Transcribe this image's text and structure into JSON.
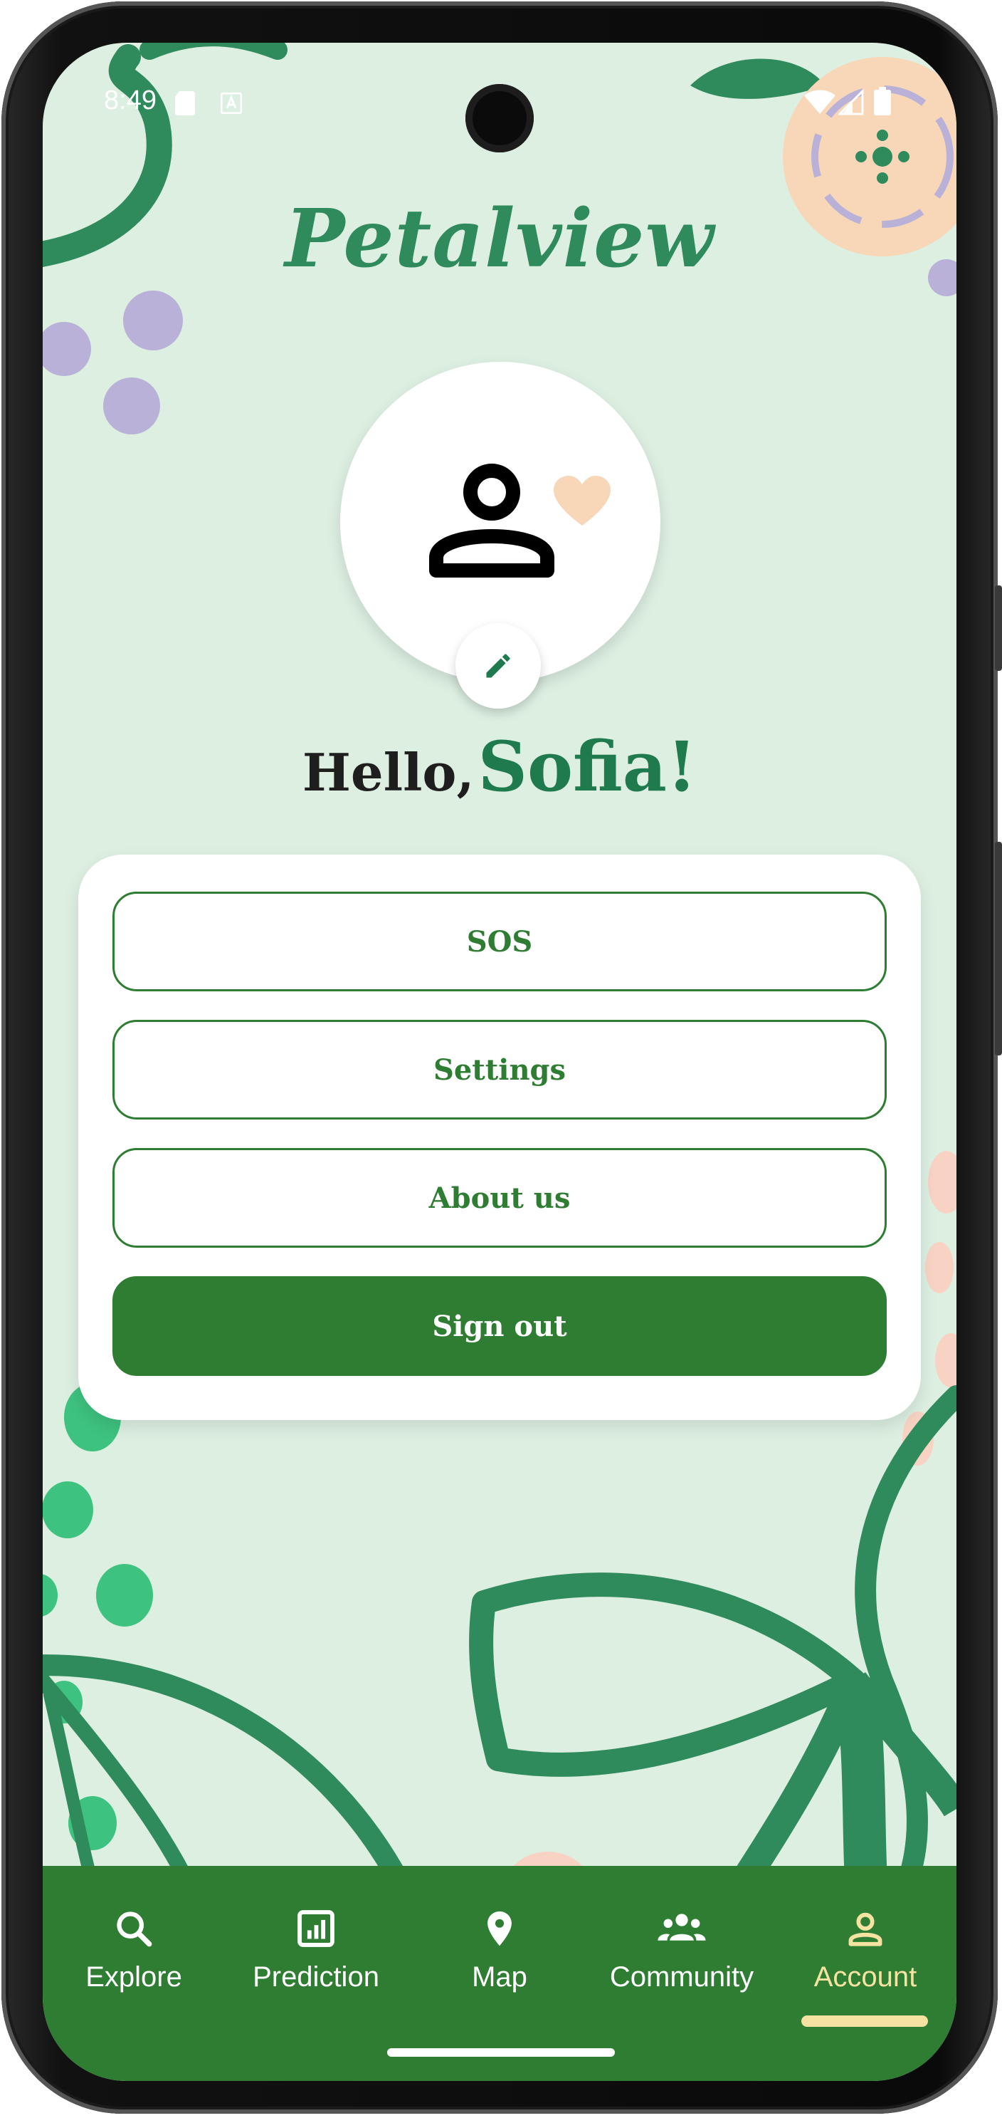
{
  "status_bar": {
    "time": "8:49"
  },
  "app": {
    "brand": "Petalview"
  },
  "profile": {
    "greeting": "Hello,",
    "name": "Sofia!"
  },
  "menu": {
    "sos_label": "SOS",
    "settings_label": "Settings",
    "about_label": "About us",
    "signout_label": "Sign out"
  },
  "bottom_nav": {
    "items": [
      {
        "label": "Explore",
        "icon": "search-icon"
      },
      {
        "label": "Prediction",
        "icon": "chart-icon"
      },
      {
        "label": "Map",
        "icon": "location-pin-icon"
      },
      {
        "label": "Community",
        "icon": "group-icon"
      },
      {
        "label": "Account",
        "icon": "person-icon",
        "active": true
      }
    ]
  },
  "colors": {
    "primary": "#2e7d32",
    "brand": "#2f8a5c",
    "background": "#dcefe1",
    "active_nav": "#f6e3a1"
  }
}
